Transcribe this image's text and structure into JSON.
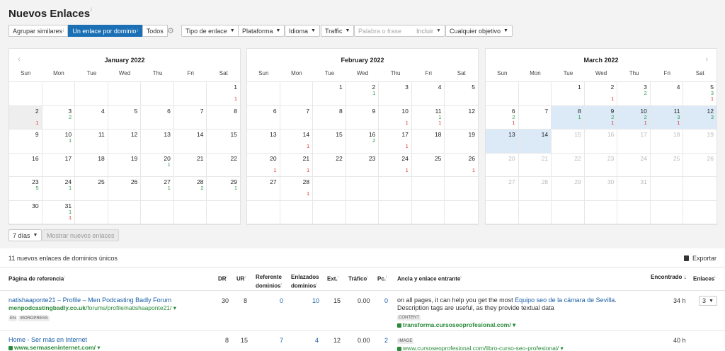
{
  "title": "Nuevos Enlaces",
  "title_info": "i",
  "toolbar": {
    "agrupar": "Agrupar similares",
    "un_enlace": "Un enlace por dominio",
    "todos": "Todos",
    "tipo": "Tipo de enlace",
    "plataforma": "Plataforma",
    "idioma": "Idioma",
    "traffic": "Traffic",
    "search_placeholder": "Palabra o frase",
    "incluir": "Incluir",
    "objetivo": "Cualquier objetivo"
  },
  "dow": [
    "Sun",
    "Mon",
    "Tue",
    "Wed",
    "Thu",
    "Fri",
    "Sat"
  ],
  "calendars": [
    {
      "month": "January 2022"
    },
    {
      "month": "February 2022"
    },
    {
      "month": "March 2022"
    }
  ],
  "bottom": {
    "range": "7 días",
    "show_btn": "Mostrar nuevos enlaces",
    "summary": "11 nuevos enlaces de dominios únicos",
    "export": "Exportar"
  },
  "table": {
    "headers": {
      "page": "Página de referencia",
      "dr": "DR",
      "ur": "UR",
      "ref": "Referente",
      "ref2": "dominios",
      "linked": "Enlazados",
      "linked2": "dominios",
      "ext": "Ext.",
      "traffic": "Tráfico",
      "pc": "Pc.",
      "anchor": "Ancla y enlace entrante",
      "found": "Encontrado",
      "links": "Enlaces"
    },
    "rows": [
      {
        "title": "natishaaponte21 – Profile – Men Podcasting Badly Forum",
        "domain": "menpodcastingbadly.co.uk",
        "path": "/forums/profile/natishaaponte21/",
        "tags": [
          "EN",
          "WORDPRESS"
        ],
        "dr": "30",
        "ur": "8",
        "ref": "0",
        "linked": "10",
        "ext": "15",
        "traffic": "0.00",
        "pc": "0",
        "anchor_pre": "on all pages, it can help you get the most ",
        "anchor_link": "Equipo seo de la cámara de Sevilla",
        "anchor_post": ". Description tags are useful, as they provide textual data",
        "anchor_tag": "CONTENT",
        "target": "transforma.cursoseoprofesional.com/",
        "found": "34 h",
        "links": "3"
      },
      {
        "title": "Home - Ser más en Internet",
        "domain": "www.sermaseninternet.com/",
        "path": "",
        "tags": [],
        "dr": "8",
        "ur": "15",
        "ref": "7",
        "linked": "4",
        "ext": "12",
        "traffic": "0.00",
        "pc": "2",
        "anchor_tag": "IMAGE",
        "target": "www.cursoseoprofesional.com/libro-curso-seo-profesional/",
        "found": "40 h"
      }
    ]
  }
}
